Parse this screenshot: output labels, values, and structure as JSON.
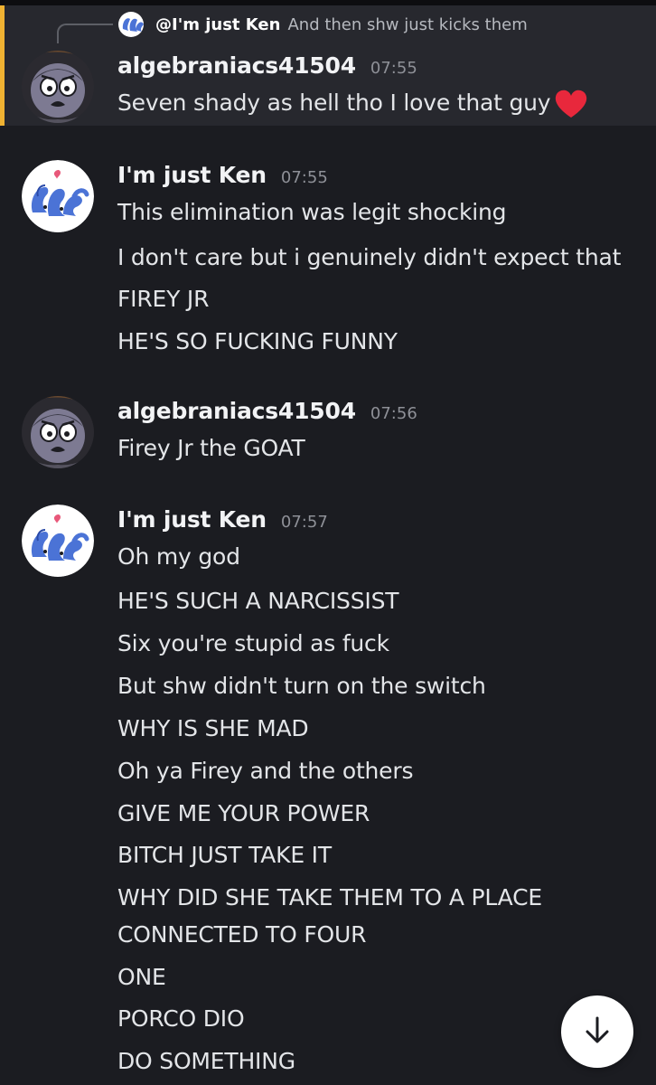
{
  "reply": {
    "mention": "@I'm just Ken",
    "preview": "And then shw just kicks them"
  },
  "messages": [
    {
      "username": "algebraniacs41504",
      "time": "07:55",
      "lines": [
        "Seven shady as hell tho I love that guy"
      ],
      "heart_emoji": "red-heart"
    },
    {
      "username": "I'm just Ken",
      "time": "07:55",
      "lines": [
        "This elimination was legit shocking",
        "I don't care but i genuinely didn't expect that",
        "FIREY JR",
        "HE'S SO FUCKING FUNNY"
      ]
    },
    {
      "username": "algebraniacs41504",
      "time": "07:56",
      "lines": [
        "Firey Jr the GOAT"
      ]
    },
    {
      "username": "I'm just Ken",
      "time": "07:57",
      "lines": [
        "Oh my god",
        "HE'S SUCH A NARCISSIST",
        "Six you're stupid as fuck",
        "But shw didn't turn on the switch",
        "WHY IS SHE MAD",
        "Oh ya Firey and the others",
        "GIVE ME YOUR POWER",
        "BITCH JUST TAKE IT",
        "WHY DID SHE TAKE THEM TO A PLACE",
        "CONNECTED TO FOUR",
        "ONE",
        "PORCO DIO",
        "DO SOMETHING"
      ]
    }
  ],
  "colors": {
    "background": "#1b1c21",
    "highlight": "#27282e",
    "highlight_border": "#f0b232",
    "heart": "#e8283c",
    "ken_avatar_blue": "#4b73d6"
  },
  "icons": {
    "scroll_button": "arrow-down-icon"
  }
}
